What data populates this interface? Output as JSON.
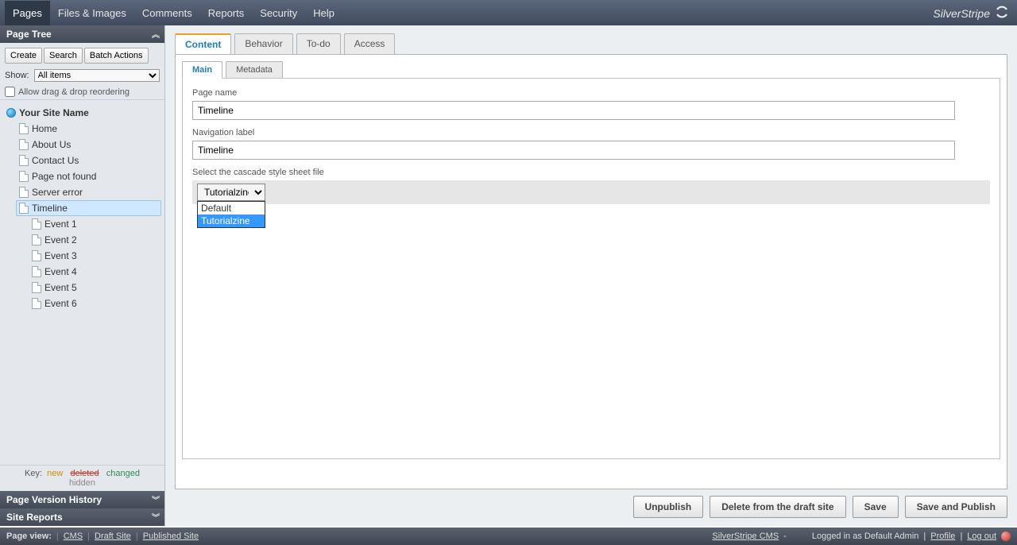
{
  "topnav": {
    "tabs": [
      "Pages",
      "Files & Images",
      "Comments",
      "Reports",
      "Security",
      "Help"
    ],
    "active": 0,
    "brand": "SilverStripe"
  },
  "sidebar": {
    "panel_title": "Page Tree",
    "buttons": {
      "create": "Create",
      "search": "Search",
      "batch": "Batch Actions"
    },
    "show_label": "Show:",
    "show_value": "All items",
    "allow_dnd": "Allow drag & drop reordering",
    "root": "Your Site Name",
    "pages": [
      "Home",
      "About Us",
      "Contact Us",
      "Page not found",
      "Server error",
      "Timeline"
    ],
    "selected": "Timeline",
    "events": [
      "Event 1",
      "Event 2",
      "Event 3",
      "Event 4",
      "Event 5",
      "Event 6"
    ],
    "key": {
      "label": "Key:",
      "new": "new",
      "deleted": "deleted",
      "changed": "changed",
      "hidden": "hidden"
    },
    "panels_bottom": {
      "history": "Page Version History",
      "reports": "Site Reports"
    }
  },
  "main": {
    "tabs1": [
      "Content",
      "Behavior",
      "To-do",
      "Access"
    ],
    "tabs1_active": 0,
    "tabs2": [
      "Main",
      "Metadata"
    ],
    "tabs2_active": 0,
    "fields": {
      "page_name_label": "Page name",
      "page_name_value": "Timeline",
      "nav_label_label": "Navigation label",
      "nav_label_value": "Timeline",
      "css_label": "Select the cascade style sheet file",
      "css_value": "Tutorialzine",
      "css_options": [
        "Default",
        "Tutorialzine"
      ],
      "css_highlighted": 1
    },
    "actions": {
      "unpublish": "Unpublish",
      "delete": "Delete from the draft site",
      "save": "Save",
      "save_publish": "Save and Publish"
    }
  },
  "footer": {
    "page_view": "Page view:",
    "links": {
      "cms": "CMS",
      "draft": "Draft Site",
      "published": "Published Site"
    },
    "right": {
      "ss_cms": "SilverStripe CMS",
      "dash": "-",
      "logged_in": "Logged in as Default Admin",
      "profile": "Profile",
      "logout": "Log out"
    }
  }
}
